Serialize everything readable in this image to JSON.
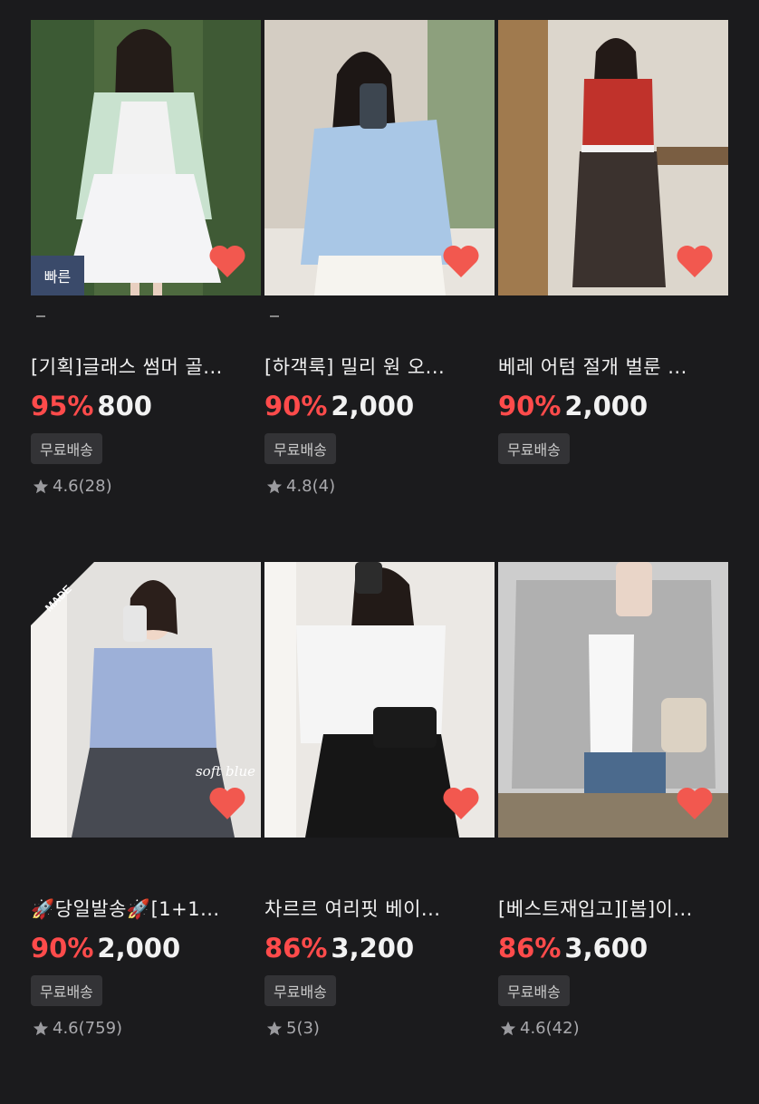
{
  "products": [
    {
      "title": "[기획]글래스 썸머 골...",
      "discount": "95%",
      "price": "800",
      "shipping": "무료배송",
      "rating": "4.6",
      "reviews": "(28)",
      "badge": "빠른",
      "colors": {
        "bg": "#5f7d4f",
        "fg": "#e9eef0"
      }
    },
    {
      "title": "[하객룩] 밀리 원 오...",
      "discount": "90%",
      "price": "2,000",
      "shipping": "무료배송",
      "rating": "4.8",
      "reviews": "(4)",
      "colors": {
        "bg": "#cfc9c0",
        "fg": "#a9c4e0"
      }
    },
    {
      "title": "베레 어텀 절개 벌룬 ...",
      "discount": "90%",
      "price": "2,000",
      "shipping": "무료배송",
      "colors": {
        "bg": "#d8d1c6",
        "fg": "#b8312a"
      }
    },
    {
      "title": "🚀당일발송🚀[1+1...",
      "discount": "90%",
      "price": "2,000",
      "shipping": "무료배송",
      "rating": "4.6",
      "reviews": "(759)",
      "ribbon": "MADE",
      "overlay_text": "soft blue",
      "colors": {
        "bg": "#e3e1de",
        "fg": "#9db0d8"
      }
    },
    {
      "title": "차르르 여리핏 베이...",
      "discount": "86%",
      "price": "3,200",
      "shipping": "무료배송",
      "rating": "5",
      "reviews": "(3)",
      "colors": {
        "bg": "#e9e6e3",
        "fg": "#f5f5f5"
      }
    },
    {
      "title": "[베스트재입고][봄]이...",
      "discount": "86%",
      "price": "3,600",
      "shipping": "무료배송",
      "rating": "4.6",
      "reviews": "(42)",
      "colors": {
        "bg": "#cfcfcf",
        "fg": "#b3b3b3"
      }
    }
  ],
  "accent": "#ff4b4b"
}
